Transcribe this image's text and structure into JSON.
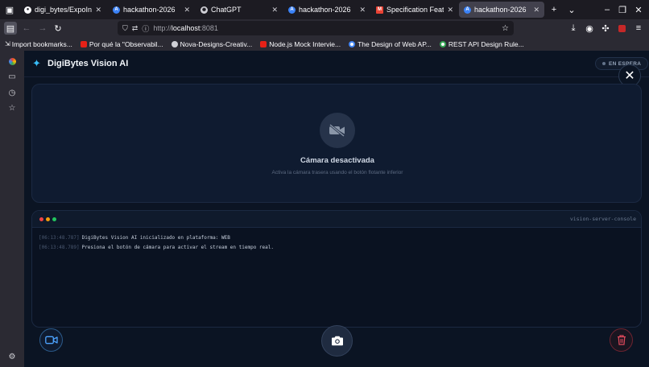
{
  "browser": {
    "tabs": [
      {
        "title": "digi_bytes/ExpoInteg",
        "icon": "github-icon"
      },
      {
        "title": "hackathon-2026",
        "icon": "app-icon"
      },
      {
        "title": "ChatGPT",
        "icon": "chatgpt-icon"
      },
      {
        "title": "hackathon-2026",
        "icon": "app-icon"
      },
      {
        "title": "Specification Feature",
        "icon": "gmail-icon"
      },
      {
        "title": "hackathon-2026",
        "icon": "app-icon",
        "active": true
      }
    ],
    "url_prefix": "http://",
    "url_host": "localhost",
    "url_suffix": ":8081",
    "bookmarks": [
      {
        "label": "Import bookmarks...",
        "icon": "import-icon"
      },
      {
        "label": "Por qué la \"Observabil...",
        "icon": "youtube-icon"
      },
      {
        "label": "Nova-Designs-Creativ...",
        "icon": "github-icon"
      },
      {
        "label": "Node.js Mock Intervie...",
        "icon": "youtube-icon"
      },
      {
        "label": "The Design of Web AP...",
        "icon": "google-icon"
      },
      {
        "label": "REST API Design Rule...",
        "icon": "google-icon"
      }
    ]
  },
  "app": {
    "brand": "DigiBytes Vision AI",
    "status": "EN ESPERA",
    "camera": {
      "title": "Cámara desactivada",
      "subtitle": "Activa la cámara trasera usando el botón flotante inferior"
    },
    "console": {
      "name": "vision-server-console",
      "logs": [
        {
          "time": "[06:13:48.787]",
          "message": "DigiBytes Vision AI inicializado en plataforma: WEB"
        },
        {
          "time": "[06:13:48.789]",
          "message": "Presiona el botón de cámara para activar el stream en tiempo real."
        }
      ]
    }
  },
  "colors": {
    "accent": "#38bdf8",
    "background": "#0b1423",
    "danger": "#e14a5c"
  }
}
